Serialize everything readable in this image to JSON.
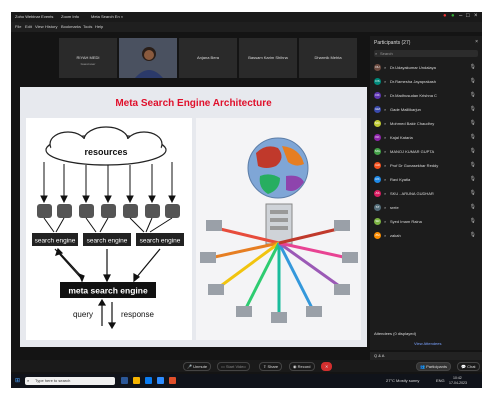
{
  "titlebar": {
    "tab1": "Zoho Webinar Events",
    "tab2": "Zoom Info",
    "tab3": "Meta Search En ×"
  },
  "menu": [
    "File",
    "Edit",
    "View",
    "History",
    "Bookmarks",
    "Tools",
    "Help"
  ],
  "thumbnails": [
    {
      "name": "RIYAH MEDI",
      "sub": "Guest user"
    },
    {
      "name": "",
      "sub": ""
    },
    {
      "name": "Anjana Bera",
      "sub": ""
    },
    {
      "name": "Bassam Karim Shihna",
      "sub": ""
    },
    {
      "name": "Dharmik Mehta",
      "sub": ""
    }
  ],
  "slide": {
    "title": "Meta Search Engine Architecture",
    "cloud_label": "resources",
    "engines": [
      "search engine",
      "search engine",
      "search engine"
    ],
    "meta_label": "meta search engine",
    "query": "query",
    "response": "response"
  },
  "panel": {
    "header": "Participants (27)",
    "search_placeholder": "Search",
    "participants": [
      {
        "initials": "DU",
        "name": "Dr.Udayakumar Undalaya"
      },
      {
        "initials": "DS",
        "name": "Dr.Ramesha Jayaprakash"
      },
      {
        "initials": "DK",
        "name": "Dr.Madhusudan Krishna C"
      },
      {
        "initials": "GM",
        "name": "Gade Malllikarjun"
      },
      {
        "initials": "MC",
        "name": "Mohmed Bakir Chaudhry"
      },
      {
        "initials": "KK",
        "name": "Kajal Kataria"
      },
      {
        "initials": "MG",
        "name": "MANOJ KUMAR GUPTA"
      },
      {
        "initials": "GR",
        "name": "Prof Dr Gunasekhar Reddy"
      },
      {
        "initials": "RK",
        "name": "Ravi Kyatla"
      },
      {
        "initials": "AS",
        "name": "SKU - ARUNA GUDHAR"
      },
      {
        "initials": "ST",
        "name": "sreie"
      },
      {
        "initials": "SR",
        "name": "Syed Imam Raina"
      },
      {
        "initials": "ZM",
        "name": "zakah"
      }
    ],
    "attendees_label": "Attendees (0 displayed)",
    "view_attendees": "View Attendees",
    "qa_label": "Q & A"
  },
  "controls": {
    "unmute": "Unmute",
    "video": "Start Video",
    "share": "Share",
    "record": "Record",
    "participants": "Participants",
    "chat": "Chat"
  },
  "taskbar": {
    "search_placeholder": "Type here to search",
    "weather": "27°C Mostly sunny",
    "lang": "ENG",
    "time": "10:42",
    "date": "17-04-2023"
  }
}
